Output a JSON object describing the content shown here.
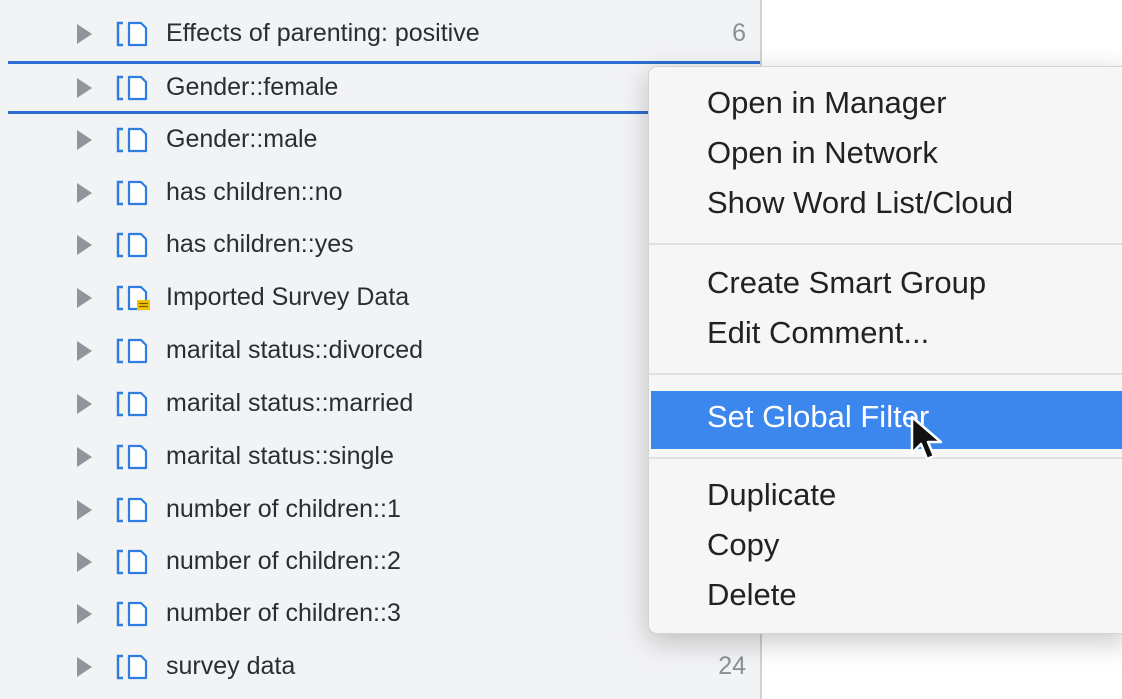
{
  "rows": [
    {
      "label": "Effects of parenting: positive",
      "count": "6",
      "icon": "code-group-icon"
    },
    {
      "label": "Gender::female",
      "count": "",
      "icon": "code-group-icon"
    },
    {
      "label": "Gender::male",
      "count": "",
      "icon": "code-group-icon"
    },
    {
      "label": "has children::no",
      "count": "",
      "icon": "code-group-icon"
    },
    {
      "label": "has children::yes",
      "count": "",
      "icon": "code-group-icon"
    },
    {
      "label": "Imported Survey Data",
      "count": "",
      "icon": "code-group-with-comment-icon"
    },
    {
      "label": "marital status::divorced",
      "count": "",
      "icon": "code-group-icon"
    },
    {
      "label": "marital status::married",
      "count": "",
      "icon": "code-group-icon"
    },
    {
      "label": "marital status::single",
      "count": "",
      "icon": "code-group-icon"
    },
    {
      "label": "number of children::1",
      "count": "",
      "icon": "code-group-icon"
    },
    {
      "label": "number of children::2",
      "count": "",
      "icon": "code-group-icon"
    },
    {
      "label": "number of children::3",
      "count": "",
      "icon": "code-group-icon"
    },
    {
      "label": "survey data",
      "count": "24",
      "icon": "code-group-icon"
    }
  ],
  "context_menu": {
    "open_in_manager": "Open in Manager",
    "open_in_network": "Open in Network",
    "show_word_list": "Show Word List/Cloud",
    "create_smart_group": "Create Smart Group",
    "edit_comment": "Edit Comment...",
    "set_global_filter": "Set Global Filter",
    "duplicate": "Duplicate",
    "copy": "Copy",
    "delete": "Delete",
    "highlighted_item": "Set Global Filter"
  },
  "colors": {
    "accent": "#3b87ee",
    "drop_indicator": "#2b6ed0",
    "icon_blue": "#2f7de1",
    "comment_badge": "#f2c200"
  }
}
